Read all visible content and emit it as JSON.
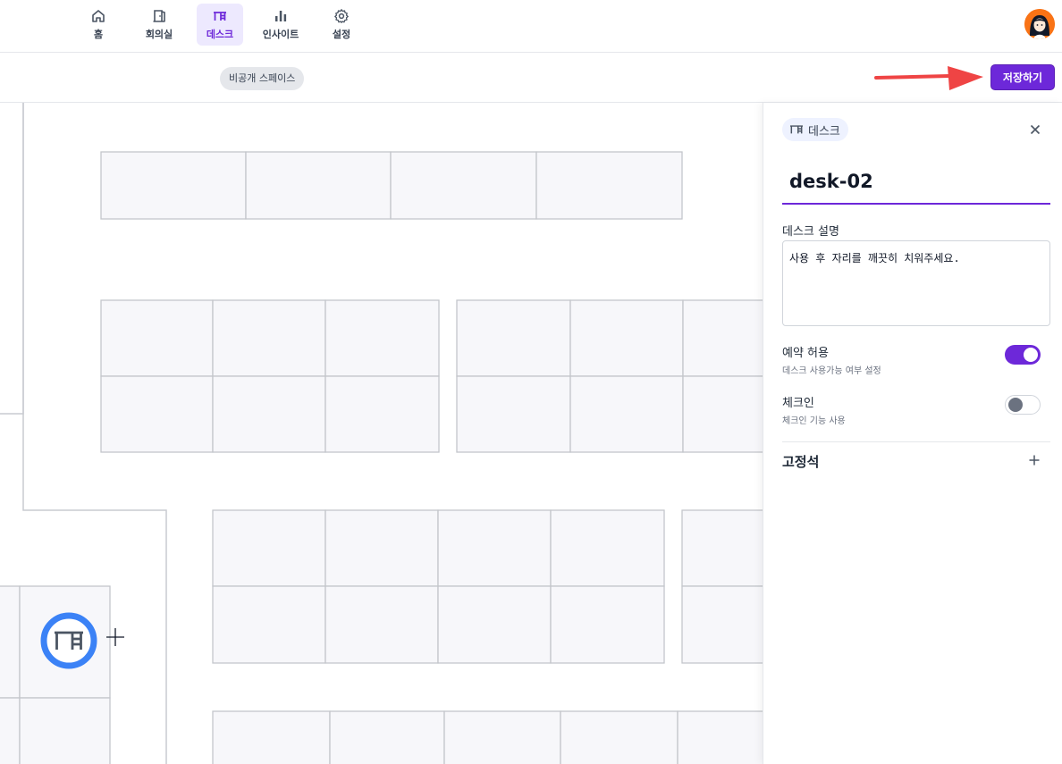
{
  "nav": {
    "items": [
      {
        "label": "홈",
        "icon": "home-icon"
      },
      {
        "label": "회의실",
        "icon": "door-icon"
      },
      {
        "label": "데스크",
        "icon": "desk-icon"
      },
      {
        "label": "인사이트",
        "icon": "bar-chart-icon"
      },
      {
        "label": "설정",
        "icon": "gear-icon"
      }
    ],
    "active_index": 2
  },
  "toolbar": {
    "space_chip": "비공개 스페이스",
    "save_label": "저장하기"
  },
  "panel": {
    "type_chip": "데스크",
    "name_value": "desk-02",
    "description_label": "데스크 설명",
    "description_value": "사용 후 자리를 깨끗히 치워주세요.",
    "reservation": {
      "title": "예약 허용",
      "subtitle": "데스크 사용가능 여부 설정",
      "enabled": true
    },
    "checkin": {
      "title": "체크인",
      "subtitle": "체크인 기능 사용",
      "enabled": false
    },
    "fixed_seat_label": "고정석"
  },
  "colors": {
    "accent": "#6d28d9",
    "arrow": "#ef4444",
    "desk_marker": "#3b82f6"
  }
}
